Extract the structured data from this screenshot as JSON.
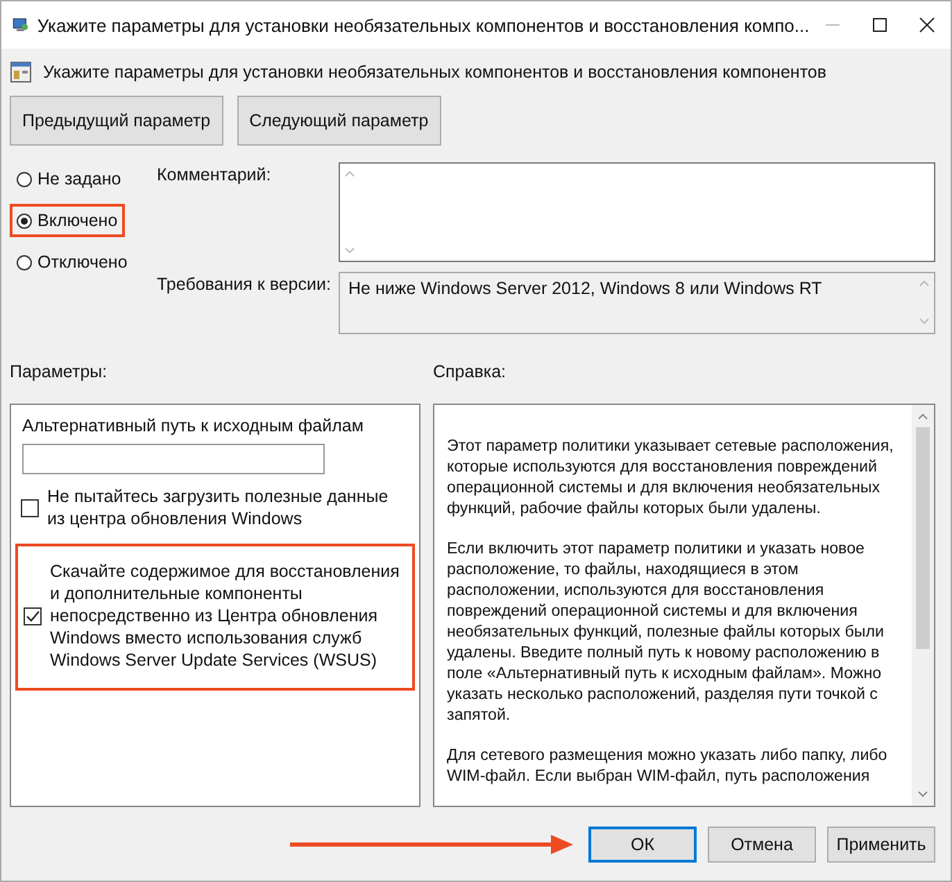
{
  "window": {
    "title": "Укажите параметры для установки необязательных компонентов и восстановления компо..."
  },
  "heading": "Укажите параметры для установки необязательных компонентов и восстановления компонентов",
  "nav_buttons": [
    "Предыдущий параметр",
    "Следующий параметр"
  ],
  "state_options": [
    {
      "label": "Не задано",
      "selected": false,
      "highlighted": false
    },
    {
      "label": "Включено",
      "selected": true,
      "highlighted": true
    },
    {
      "label": "Отключено",
      "selected": false,
      "highlighted": false
    }
  ],
  "comment": {
    "label": "Комментарий:"
  },
  "version": {
    "label": "Требования к версии:",
    "value": "Не ниже Windows Server 2012, Windows 8 или Windows RT"
  },
  "options": {
    "label": "Параметры:",
    "path_label": "Альтернативный путь к исходным файлам",
    "checkboxes": [
      {
        "label": "Не пытайтесь загрузить полезные данные из центра обновления Windows",
        "checked": false,
        "highlighted": false
      },
      {
        "label": "Скачайте содержимое для восстановления и дополнительные компоненты непосредственно из Центра обновления Windows вместо использования служб Windows Server Update Services (WSUS)",
        "checked": true,
        "highlighted": true
      }
    ]
  },
  "help": {
    "label": "Справка:",
    "paragraphs": [
      "Этот параметр политики указывает сетевые расположения, которые используются для восстановления повреждений операционной системы и для включения необязательных функций, рабочие файлы которых были удалены.",
      "Если включить этот параметр политики и указать новое расположение, то файлы, находящиеся в этом расположении, используются для восстановления повреждений операционной системы и для включения необязательных функций, полезные файлы которых были удалены. Введите полный путь к новому расположению в поле «Альтернативный путь к исходным файлам». Можно указать несколько расположений, разделяя пути точкой с запятой.",
      "Для сетевого размещения можно указать либо папку, либо WIM-файл. Если выбран WIM-файл, путь расположения"
    ]
  },
  "buttons": [
    {
      "label": "ОК",
      "focused": true,
      "arrow": true
    },
    {
      "label": "Отмена",
      "focused": false,
      "arrow": false
    },
    {
      "label": "Применить",
      "focused": false,
      "arrow": false
    }
  ]
}
